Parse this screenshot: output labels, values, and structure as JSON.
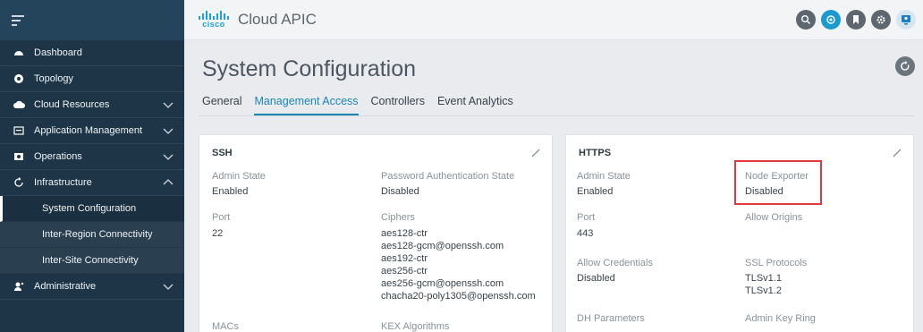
{
  "app": {
    "title": "Cloud APIC",
    "logo_text": "cisco"
  },
  "sidebar": {
    "items": [
      {
        "label": "Dashboard",
        "icon": "dashboard-icon"
      },
      {
        "label": "Topology",
        "icon": "topology-icon"
      },
      {
        "label": "Cloud Resources",
        "icon": "cloud-icon"
      },
      {
        "label": "Application Management",
        "icon": "application-icon"
      },
      {
        "label": "Operations",
        "icon": "operations-icon"
      },
      {
        "label": "Infrastructure",
        "icon": "infrastructure-icon"
      },
      {
        "label": "Administrative",
        "icon": "admin-icon"
      }
    ],
    "subitems": [
      {
        "label": "System Configuration"
      },
      {
        "label": "Inter-Region Connectivity"
      },
      {
        "label": "Inter-Site Connectivity"
      }
    ]
  },
  "page": {
    "title": "System Configuration"
  },
  "tabs": [
    "General",
    "Management Access",
    "Controllers",
    "Event Analytics"
  ],
  "ssh": {
    "title": "SSH",
    "admin_state_label": "Admin State",
    "admin_state": "Enabled",
    "pwd_auth_label": "Password Authentication State",
    "pwd_auth": "Disabled",
    "port_label": "Port",
    "port": "22",
    "ciphers_label": "Ciphers",
    "ciphers": [
      "aes128-ctr",
      "aes128-gcm@openssh.com",
      "aes192-ctr",
      "aes256-ctr",
      "aes256-gcm@openssh.com",
      "chacha20-poly1305@openssh.com"
    ],
    "macs_label": "MACs",
    "kex_label": "KEX Algorithms"
  },
  "https": {
    "title": "HTTPS",
    "admin_state_label": "Admin State",
    "admin_state": "Enabled",
    "node_exporter_label": "Node Exporter",
    "node_exporter": "Disabled",
    "port_label": "Port",
    "port": "443",
    "allow_origins_label": "Allow Origins",
    "allow_credentials_label": "Allow Credentials",
    "allow_credentials": "Disabled",
    "ssl_protocols_label": "SSL Protocols",
    "ssl_protocols": [
      "TLSv1.1",
      "TLSv1.2"
    ],
    "dh_params_label": "DH Parameters",
    "admin_key_ring_label": "Admin Key Ring"
  },
  "colors": {
    "sidebar": "#1e3547",
    "accent": "#1a86b8",
    "highlight": "#e0393e"
  }
}
